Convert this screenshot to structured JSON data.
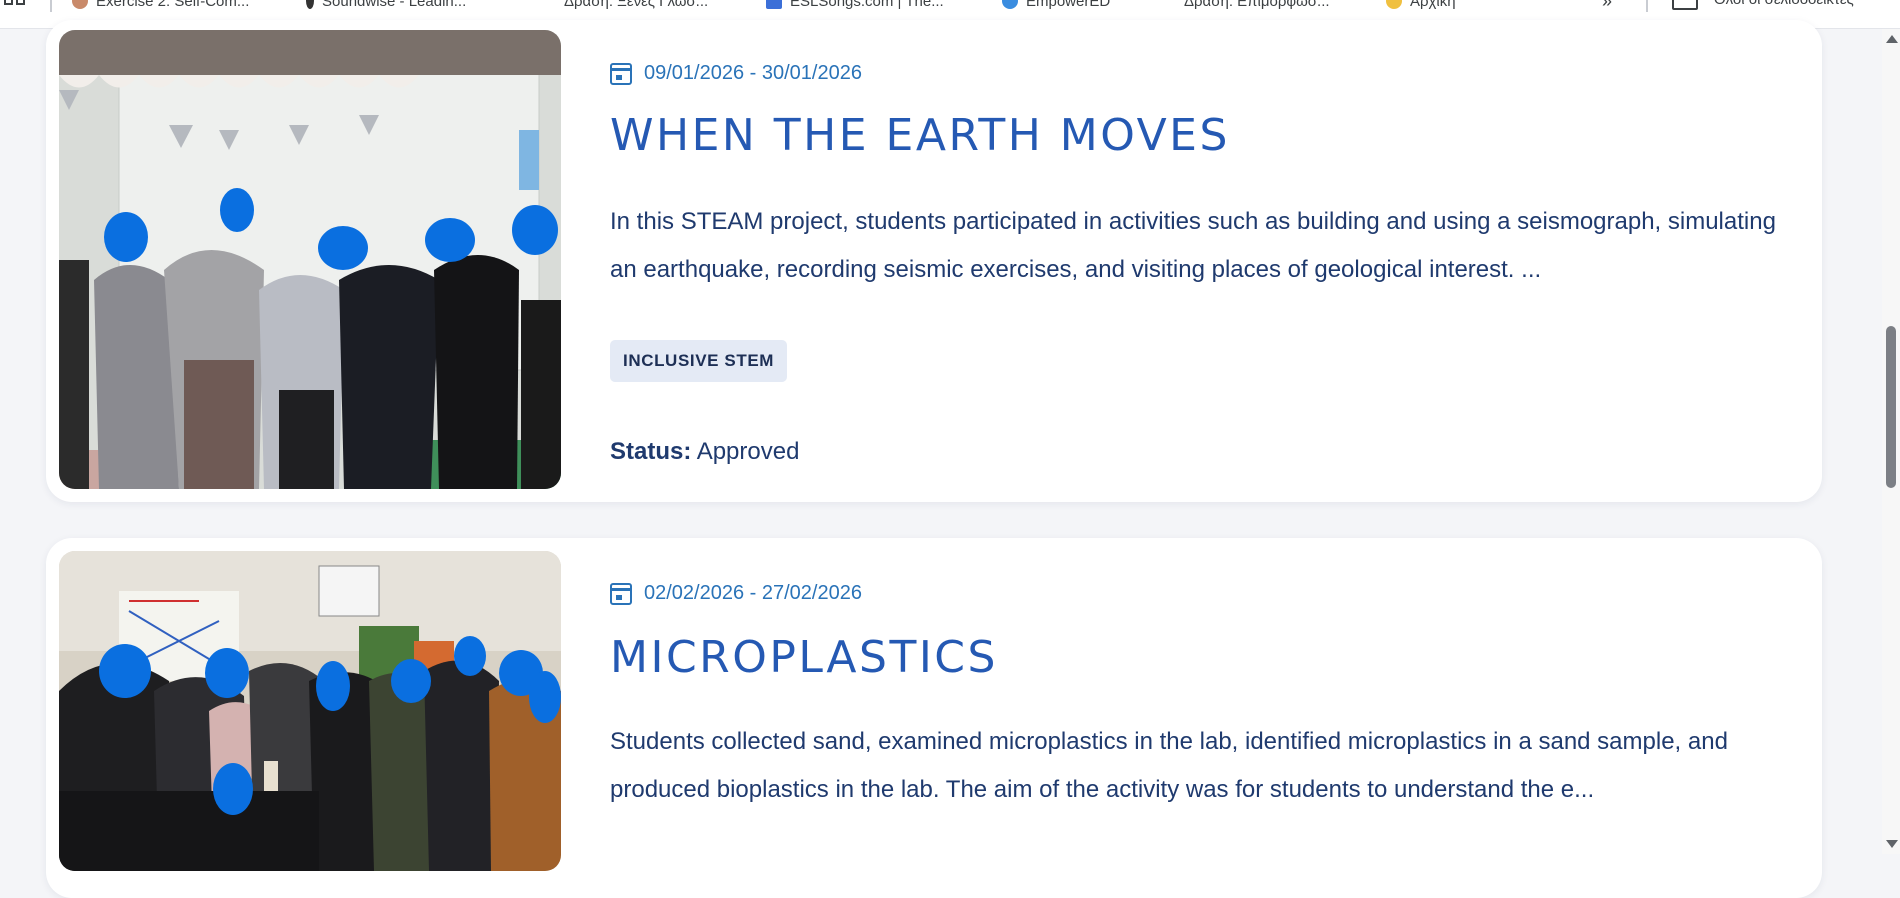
{
  "bookmarks": [
    {
      "label": "Exercise 2: Self-Com...",
      "color": "#c98a6a"
    },
    {
      "label": "Soundwise - Leadin...",
      "color": "#333333"
    },
    {
      "label": "Δράση: Ξένες Γλώσ...",
      "color": "#ffffff"
    },
    {
      "label": "ESLSongs.com | The...",
      "color": "#3b6fd8"
    },
    {
      "label": "EmpowerED",
      "color": "#3a8de0"
    },
    {
      "label": "Δράση: Επιμόρφωσ...",
      "color": "#ffffff"
    },
    {
      "label": "Αρχική",
      "color": "#f0c040"
    }
  ],
  "all_bookmarks_label": "Όλοι οι σελιδοδείκτες",
  "overflow_label": "»",
  "cards": [
    {
      "date_range": "09/01/2026 - 30/01/2026",
      "title": "WHEN THE EARTH MOVES",
      "description": "In this STEAM project, students participated in activities such as building and using a seismograph, simulating an earthquake, recording seismic exercises, and visiting places of geological interest. ...",
      "tag": "INCLUSIVE STEM",
      "status_label": "Status:",
      "status_value": "Approved"
    },
    {
      "date_range": "02/02/2026 - 27/02/2026",
      "title": "MICROPLASTICS",
      "description": "Students collected sand, examined microplastics in the lab, identified microplastics in a sand sample, and produced bioplastics in the lab. The aim of the activity was for students to understand the e..."
    }
  ],
  "colors": {
    "accent_date": "#2a73b8",
    "title": "#2559b3",
    "text": "#1f3a6e",
    "tag_bg": "#e4eaf5",
    "blur_mark": "#0a6fe0"
  }
}
